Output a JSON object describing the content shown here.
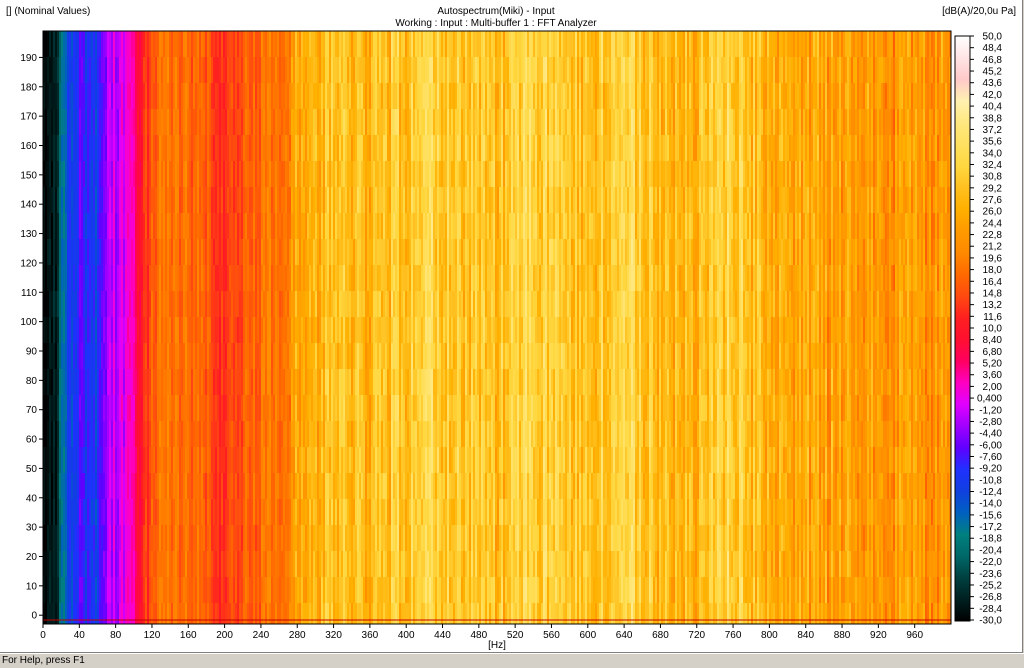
{
  "header": {
    "left_label": "[] (Nominal Values)",
    "title": "Autospectrum(Miki) - Input",
    "subtitle": "Working : Input : Multi-buffer 1 : FFT Analyzer",
    "unit_label": "[dB(A)/20,0u Pa]"
  },
  "status_bar": {
    "text": "For Help, press F1"
  },
  "chart_data": {
    "type": "heatmap",
    "title": "Autospectrum(Miki) - Input",
    "subtitle": "Working : Input : Multi-buffer 1 : FFT Analyzer",
    "xlabel": "[Hz]",
    "ylabel": "",
    "zlabel": "[dB(A)/20,0u Pa]",
    "xlim": [
      0,
      1000
    ],
    "ylim": [
      -3,
      199
    ],
    "x_ticks": [
      "0",
      "40",
      "80",
      "120",
      "160",
      "200",
      "240",
      "280",
      "320",
      "360",
      "400",
      "440",
      "480",
      "520",
      "560",
      "600",
      "640",
      "680",
      "720",
      "760",
      "800",
      "840",
      "880",
      "920",
      "960"
    ],
    "y_ticks": [
      "0",
      "10",
      "20",
      "30",
      "40",
      "50",
      "60",
      "70",
      "80",
      "90",
      "100",
      "110",
      "120",
      "130",
      "140",
      "150",
      "160",
      "170",
      "180",
      "190"
    ],
    "colorbar_labels": [
      "50,0",
      "48,4",
      "46,8",
      "45,2",
      "43,6",
      "42,0",
      "40,4",
      "38,8",
      "37,2",
      "35,6",
      "34,0",
      "32,4",
      "30,8",
      "29,2",
      "27,6",
      "26,0",
      "24,4",
      "22,8",
      "21,2",
      "19,6",
      "18,0",
      "16,4",
      "14,8",
      "13,2",
      "11,6",
      "10,0",
      "8,40",
      "6,80",
      "5,20",
      "3,60",
      "2,00",
      "0,400",
      "-1,20",
      "-2,80",
      "-4,40",
      "-6,00",
      "-7,60",
      "-9,20",
      "-10,8",
      "-12,4",
      "-14,0",
      "-15,6",
      "-17,2",
      "-18,8",
      "-20,4",
      "-22,0",
      "-23,6",
      "-25,2",
      "-26,8",
      "-28,4",
      "-30,0"
    ],
    "colorbar_colors": [
      "#ffffff",
      "#ffe4e4",
      "#ffc9c9",
      "#fff0b0",
      "#ffe880",
      "#ffe060",
      "#ffd840",
      "#ffc020",
      "#ffb000",
      "#ff9a00",
      "#ff8a00",
      "#ff6a00",
      "#ff4a10",
      "#ff2020",
      "#ff1030",
      "#ff0060",
      "#ff00c0",
      "#e000ff",
      "#a000ff",
      "#6000ff",
      "#2030ff",
      "#1040e0",
      "#0060c0",
      "#008080",
      "#006868",
      "#004040",
      "#002020",
      "#000000"
    ],
    "spectrum_profile": [
      {
        "hz": 0,
        "db": -30.0
      },
      {
        "hz": 15,
        "db": -26.0
      },
      {
        "hz": 25,
        "db": -14.0
      },
      {
        "hz": 40,
        "db": -8.0
      },
      {
        "hz": 60,
        "db": -12.0
      },
      {
        "hz": 70,
        "db": -2.0
      },
      {
        "hz": 85,
        "db": -1.0
      },
      {
        "hz": 98,
        "db": 2.0
      },
      {
        "hz": 108,
        "db": 11.0
      },
      {
        "hz": 130,
        "db": 19.0
      },
      {
        "hz": 180,
        "db": 16.0
      },
      {
        "hz": 200,
        "db": 12.0
      },
      {
        "hz": 220,
        "db": 15.0
      },
      {
        "hz": 270,
        "db": 20.0
      },
      {
        "hz": 285,
        "db": 27.0
      },
      {
        "hz": 380,
        "db": 29.0
      },
      {
        "hz": 430,
        "db": 33.0
      },
      {
        "hz": 470,
        "db": 30.0
      },
      {
        "hz": 500,
        "db": 29.0
      },
      {
        "hz": 540,
        "db": 33.0
      },
      {
        "hz": 580,
        "db": 29.0
      },
      {
        "hz": 620,
        "db": 31.0
      },
      {
        "hz": 640,
        "db": 33.0
      },
      {
        "hz": 680,
        "db": 28.0
      },
      {
        "hz": 720,
        "db": 27.0
      },
      {
        "hz": 760,
        "db": 33.0
      },
      {
        "hz": 790,
        "db": 27.0
      },
      {
        "hz": 880,
        "db": 24.0
      },
      {
        "hz": 930,
        "db": 23.0
      },
      {
        "hz": 1000,
        "db": 22.0
      }
    ],
    "grid": false,
    "legend": "colorbar-right"
  }
}
